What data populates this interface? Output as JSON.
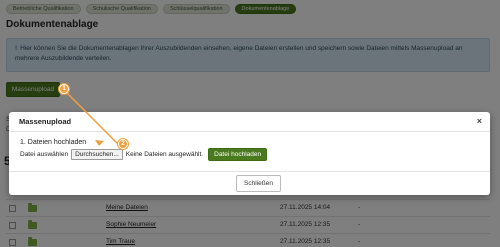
{
  "tabs": [
    {
      "label": "Betriebliche Qualifikation"
    },
    {
      "label": "Schulische Qualifikation"
    },
    {
      "label": "Schlüsselqualifikation"
    },
    {
      "label": "Dokumentenablage"
    }
  ],
  "page_title": "Dokumentenablage",
  "info_text": "Hier können Sie die Dokumentenablagen Ihrer Auszubildenden einsehen, eigene Dateien erstellen und speichern sowie Dateien mittels Massenupload an mehrere Auszubildende verteilen.",
  "mass_upload_button": "Massenupload",
  "background_fragments": {
    "sie": "Sie",
    "doi": "Doi",
    "five": "5"
  },
  "table_rows": [
    {
      "name": "Meine Dateien",
      "date": "27.11.2025 14:04",
      "extra": "-"
    },
    {
      "name": "Sophie Neumeier",
      "date": "27.11.2025 12:35",
      "extra": "-"
    },
    {
      "name": "Tim Traue",
      "date": "27.11.2025 12:35",
      "extra": "-"
    }
  ],
  "modal": {
    "title": "Massenupload",
    "close_symbol": "×",
    "step_label": "1. Dateien hochladen",
    "file_label": "Datei auswählen",
    "browse_button": "Durchsuchen...",
    "no_file_text": "Keine Dateien ausgewählt.",
    "upload_button": "Datei hochladen",
    "close_button": "Schließen"
  },
  "annotations": [
    {
      "number": "1"
    },
    {
      "number": "2"
    }
  ],
  "colors": {
    "accent_green": "#4a7a1e",
    "annotation_orange": "#f0a040",
    "info_bg": "#d6e8f5"
  }
}
